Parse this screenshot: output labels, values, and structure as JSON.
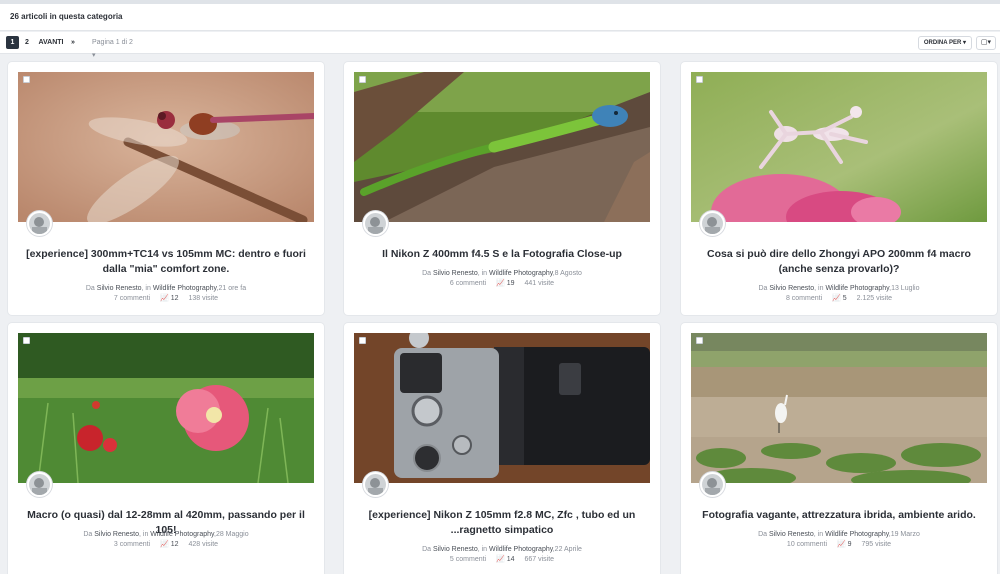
{
  "header": {
    "article_count": "26 articoli in questa categoria"
  },
  "pagination": {
    "current": "1",
    "page2": "2",
    "next": "AVANTI",
    "last": "»",
    "jump": "Pagina 1 di 2 ▾",
    "sort": "ORDINA PER ▾",
    "view_icon": "layout-icon"
  },
  "labels": {
    "by": "Da",
    "in": ", in"
  },
  "articles": [
    {
      "title": "[experience] 300mm+TC14 vs 105mm MC: dentro e fuori dalla \"mia\" comfort zone.",
      "author": "Silvio Renesto",
      "category": "Wildlife Photography",
      "date": "21 ore fa",
      "comments": "7 commenti",
      "reactions": "12",
      "views": "138 visite"
    },
    {
      "title": "Il Nikon Z 400mm f4.5 S e la Fotografia Close-up",
      "author": "Silvio Renesto",
      "category": "Wildlife Photography",
      "date": "8 Agosto",
      "comments": "6 commenti",
      "reactions": "19",
      "views": "441 visite"
    },
    {
      "title": "Cosa si può dire dello Zhongyi APO 200mm f4 macro (anche senza provarlo)?",
      "author": "Silvio Renesto",
      "category": "Wildlife Photography",
      "date": "13 Luglio",
      "comments": "8 commenti",
      "reactions": "5",
      "views": "2.125 visite"
    },
    {
      "title": "Macro (o quasi) dal 12-28mm al 420mm, passando per il 105!",
      "author": "Silvio Renesto",
      "category": "Wildlife Photography",
      "date": "28 Maggio",
      "comments": "3 commenti",
      "reactions": "12",
      "views": "428 visite"
    },
    {
      "title": "[experience] Nikon Z 105mm f2.8 MC, Zfc , tubo ed un ...ragnetto simpatico",
      "author": "Silvio Renesto",
      "category": "Wildlife Photography",
      "date": "22 Aprile",
      "comments": "5 commenti",
      "reactions": "14",
      "views": "667 visite"
    },
    {
      "title": "Fotografia vagante, attrezzatura ibrida, ambiente arido.",
      "author": "Silvio Renesto",
      "category": "Wildlife Photography",
      "date": "19 Marzo",
      "comments": "10 commenti",
      "reactions": "9",
      "views": "795 visite"
    }
  ]
}
